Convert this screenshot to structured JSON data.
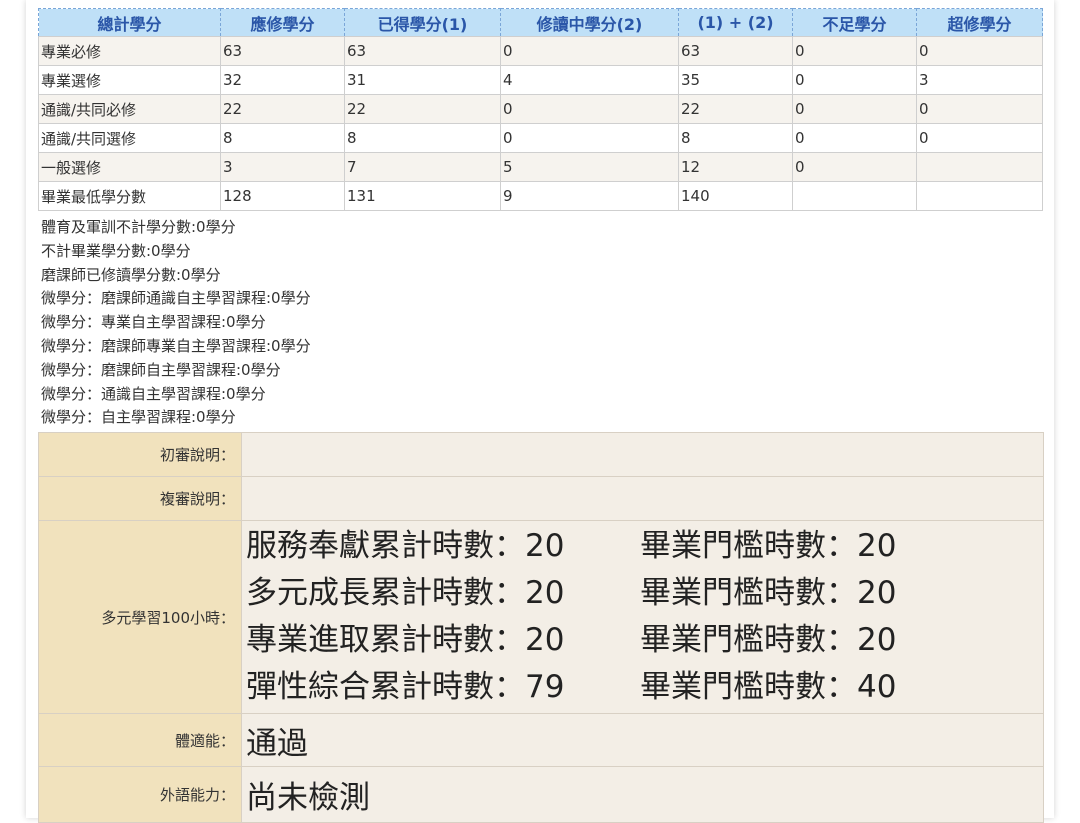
{
  "credit_table": {
    "headers": [
      "總計學分",
      "應修學分",
      "已得學分(1)",
      "修讀中學分(2)",
      "(1) + (2)",
      "不足學分",
      "超修學分"
    ],
    "rows": [
      [
        "專業必修",
        "63",
        "63",
        "0",
        "63",
        "0",
        "0"
      ],
      [
        "專業選修",
        "32",
        "31",
        "4",
        "35",
        "0",
        "3"
      ],
      [
        "通識/共同必修",
        "22",
        "22",
        "0",
        "22",
        "0",
        "0"
      ],
      [
        "通識/共同選修",
        "8",
        "8",
        "0",
        "8",
        "0",
        "0"
      ],
      [
        "一般選修",
        "3",
        "7",
        "5",
        "12",
        "0",
        ""
      ],
      [
        "畢業最低學分數",
        "128",
        "131",
        "9",
        "140",
        "",
        ""
      ]
    ]
  },
  "notes": [
    "體育及軍訓不計學分數:0學分",
    "不計畢業學分數:0學分",
    "磨課師已修讀學分數:0學分",
    "微學分：磨課師通識自主學習課程:0學分",
    "微學分：專業自主學習課程:0學分",
    "微學分：磨課師專業自主學習課程:0學分",
    "微學分：磨課師自主學習課程:0學分",
    "微學分：通識自主學習課程:0學分",
    "微學分：自主學習課程:0學分"
  ],
  "info": {
    "initial_review_label": "初審說明：",
    "initial_review_value": "",
    "second_review_label": "複審說明：",
    "second_review_value": "",
    "learning_hours_label": "多元學習100小時：",
    "learning_hours": [
      {
        "accumulated": "服務奉獻累計時數：20",
        "threshold": "畢業門檻時數：20"
      },
      {
        "accumulated": "多元成長累計時數：20",
        "threshold": "畢業門檻時數：20"
      },
      {
        "accumulated": "專業進取累計時數：20",
        "threshold": "畢業門檻時數：20"
      },
      {
        "accumulated": "彈性綜合累計時數：79",
        "threshold": "畢業門檻時數：40"
      }
    ],
    "fitness_label": "體適能：",
    "fitness_value": "通過",
    "language_label": "外語能力：",
    "language_value": "尚未檢測"
  },
  "colors": {
    "header_bg": "#bfe0f7",
    "header_text": "#2a56a8",
    "row_alt_bg": "#f6f3ee",
    "label_bg": "#f1e2bd",
    "value_bg": "#f3eee6"
  }
}
